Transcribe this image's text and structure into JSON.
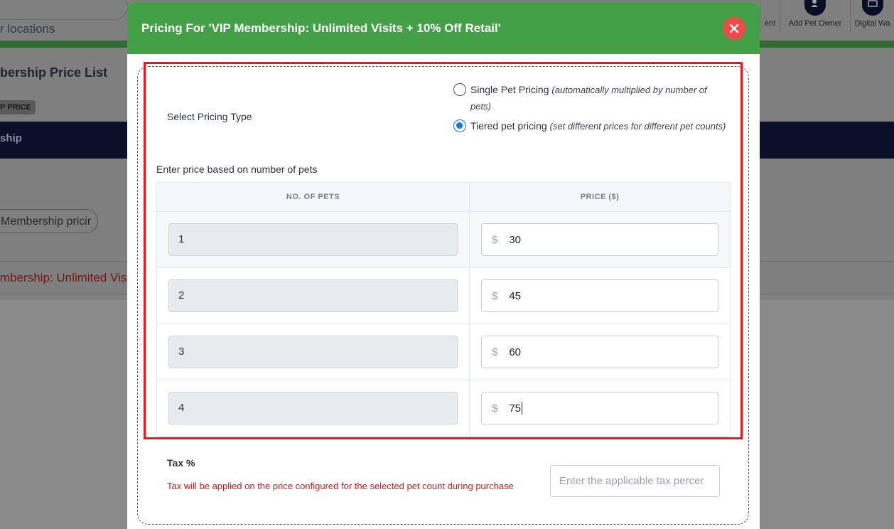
{
  "background": {
    "search_hint": "r locations",
    "page_title": "bership Price List",
    "badge": "P PRICE",
    "nav_item": "ship",
    "pill_button": "Membership pricir",
    "list_link": "mbership: Unlimited Visit",
    "toolbar": [
      {
        "label": "ent",
        "icon": "add-client-icon"
      },
      {
        "label": "Add Pet Owner",
        "icon": "add-pet-owner-icon"
      },
      {
        "label": "Digital Wa",
        "icon": "digital-wallet-icon"
      }
    ]
  },
  "modal": {
    "title": "Pricing For 'VIP Membership: Unlimited Visits + 10% Off Retail'",
    "close_icon": "close-icon",
    "select_pricing_type_label": "Select Pricing Type",
    "options": [
      {
        "label": "Single Pet Pricing",
        "hint": "(automatically multiplied by number of pets)",
        "selected": false
      },
      {
        "label": "Tiered pet pricing",
        "hint": "(set different prices for different pet counts)",
        "selected": true
      }
    ],
    "enter_price_label": "Enter price based on number of pets",
    "table": {
      "headers": [
        "NO. OF PETS",
        "PRICE ($)"
      ],
      "currency_symbol": "$",
      "rows": [
        {
          "pets": "1",
          "price": "30"
        },
        {
          "pets": "2",
          "price": "45"
        },
        {
          "pets": "3",
          "price": "60"
        },
        {
          "pets": "4",
          "price": "75"
        }
      ]
    },
    "tax": {
      "label": "Tax %",
      "note": "Tax will be applied on the price configured for the selected pet count during purchase",
      "placeholder": "Enter the applicable tax percer"
    }
  },
  "colors": {
    "header_green": "#43a047",
    "close_red": "#ef4a4a",
    "highlight_red": "#e11b22",
    "radio_blue": "#1976d2"
  }
}
